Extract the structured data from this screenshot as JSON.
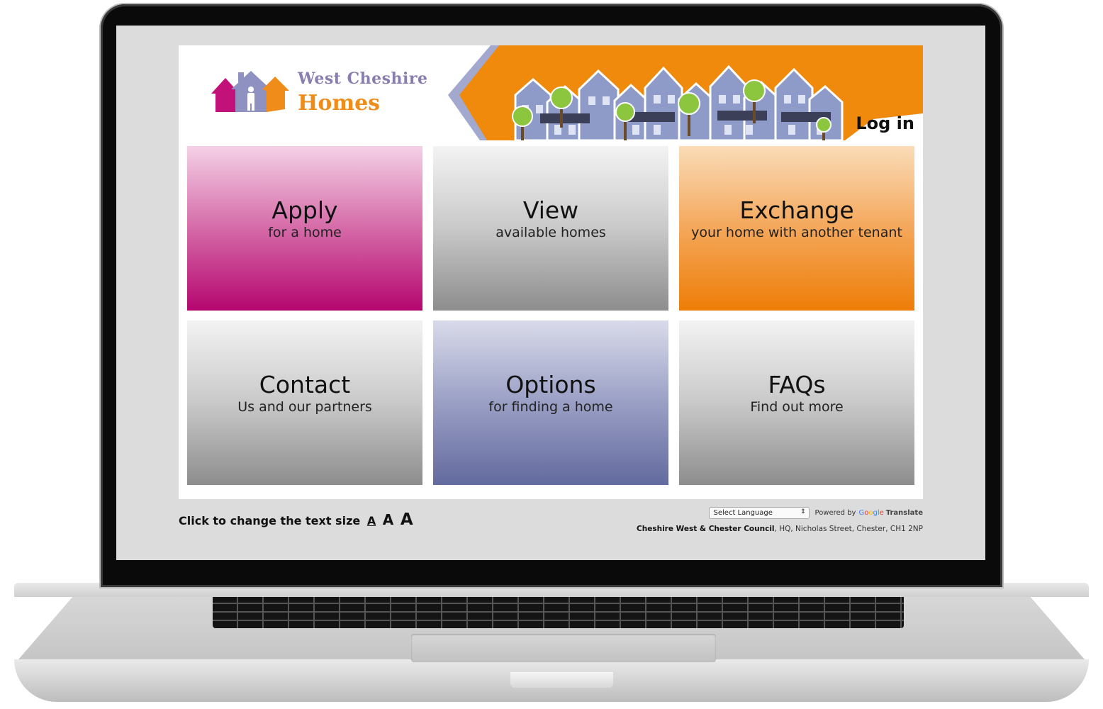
{
  "site": {
    "logo_line1": "West Cheshire",
    "logo_line2": "Homes",
    "login_label": "Log in"
  },
  "tiles": [
    {
      "title": "Apply",
      "subtitle": "for a home",
      "color": "#b5066f"
    },
    {
      "title": "View",
      "subtitle": "available homes",
      "color": "#8d8d8d"
    },
    {
      "title": "Exchange",
      "subtitle": "your home with another tenant",
      "color": "#ee7d07"
    },
    {
      "title": "Contact",
      "subtitle": "Us and our partners",
      "color": "#8d8d8d"
    },
    {
      "title": "Options",
      "subtitle": "for finding a home",
      "color": "#636a9e"
    },
    {
      "title": "FAQs",
      "subtitle": "Find out more",
      "color": "#8d8d8d"
    }
  ],
  "footer": {
    "text_size_label": "Click to change the text size",
    "text_size_options": [
      "A",
      "A",
      "A"
    ],
    "language_select": "Select Language",
    "powered_by": "Powered by",
    "google": [
      "G",
      "o",
      "o",
      "g",
      "l",
      "e"
    ],
    "translate": "Translate",
    "address_org": "Cheshire West & Chester Council",
    "address_rest": ", HQ, Nicholas Street, Chester, CH1 2NP"
  },
  "colors": {
    "brand_purple": "#8a7db0",
    "brand_orange": "#f08c1a",
    "banner_orange": "#ef8a0c"
  }
}
